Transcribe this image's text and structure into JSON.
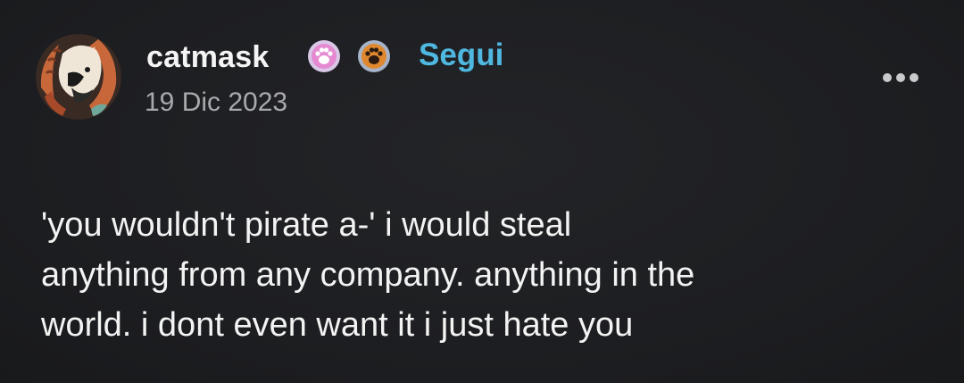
{
  "post": {
    "author": {
      "username": "catmask",
      "avatar_icon": "cat-avatar-icon"
    },
    "badges": [
      {
        "icon": "pink-paw-badge-icon",
        "color": "#e58ad0"
      },
      {
        "icon": "orange-paw-badge-icon",
        "color": "#e0882f"
      }
    ],
    "follow_label": "Segui",
    "date": "19 Dic 2023",
    "more_icon": "ellipsis-icon",
    "body": "'you wouldn't pirate a-' i would steal\nanything from any company. anything in the\nworld. i dont even want it i just hate you"
  },
  "colors": {
    "background": "#1e1f22",
    "follow": "#4fb8e0",
    "date": "#a9aaad",
    "text": "#f3f3f3"
  }
}
